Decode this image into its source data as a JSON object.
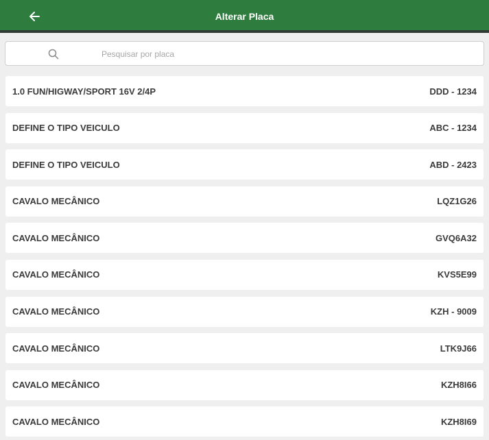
{
  "header": {
    "title": "Alterar Placa",
    "back_icon": "arrow-left-icon"
  },
  "search": {
    "placeholder": "Pesquisar por placa",
    "value": "",
    "icon": "search-icon"
  },
  "vehicles": [
    {
      "model": "1.0 FUN/HIGWAY/SPORT 16V 2/4P",
      "plate": "DDD - 1234"
    },
    {
      "model": "DEFINE O TIPO VEICULO",
      "plate": "ABC - 1234"
    },
    {
      "model": "DEFINE O TIPO VEICULO",
      "plate": "ABD - 2423"
    },
    {
      "model": "CAVALO MECÂNICO",
      "plate": "LQZ1G26"
    },
    {
      "model": "CAVALO MECÂNICO",
      "plate": "GVQ6A32"
    },
    {
      "model": "CAVALO MECÂNICO",
      "plate": "KVS5E99"
    },
    {
      "model": "CAVALO MECÂNICO",
      "plate": "KZH - 9009"
    },
    {
      "model": "CAVALO MECÂNICO",
      "plate": "LTK9J66"
    },
    {
      "model": "CAVALO MECÂNICO",
      "plate": "KZH8I66"
    },
    {
      "model": "CAVALO MECÂNICO",
      "plate": "KZH8I69"
    }
  ],
  "colors": {
    "header_bg": "#2e7d3e",
    "header_border": "#2f3a34",
    "page_bg": "#efefef",
    "text": "#3a3a3a"
  }
}
